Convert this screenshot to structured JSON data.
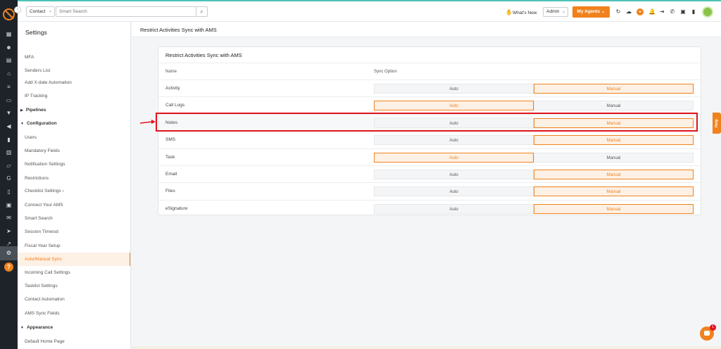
{
  "colors": {
    "accent": "#f0821e",
    "highlight": "#e0141e",
    "rail": "#1e2329"
  },
  "topbar": {
    "context_select": "Contact",
    "search_placeholder": "Smart Search",
    "whats_new": "What's New",
    "role_select": "Admin",
    "my_agents": "My Agents"
  },
  "sidebar": {
    "title": "Settings",
    "items": [
      {
        "label": "MFA",
        "type": "item"
      },
      {
        "label": "Senders List",
        "type": "item"
      },
      {
        "label": "Add X-date Automation",
        "type": "item"
      },
      {
        "label": "IP Tracking",
        "type": "item"
      },
      {
        "label": "Pipelines",
        "type": "section"
      },
      {
        "label": "Configuration",
        "type": "section"
      },
      {
        "label": "Users",
        "type": "item"
      },
      {
        "label": "Mandatory Fields",
        "type": "item"
      },
      {
        "label": "Notification Settings",
        "type": "item"
      },
      {
        "label": "Restrictions",
        "type": "item"
      },
      {
        "label": "Checklist Settings",
        "type": "item"
      },
      {
        "label": "Connect Your AMS",
        "type": "item"
      },
      {
        "label": "Smart Search",
        "type": "item"
      },
      {
        "label": "Session Timeout",
        "type": "item"
      },
      {
        "label": "Fiscal Year Setup",
        "type": "item"
      },
      {
        "label": "Auto/Manual Sync",
        "type": "item-active"
      },
      {
        "label": "Incoming Call Settings",
        "type": "item"
      },
      {
        "label": "Tasklist Settings",
        "type": "item"
      },
      {
        "label": "Contact Automation",
        "type": "item"
      },
      {
        "label": "AMS Sync Fields",
        "type": "item"
      },
      {
        "label": "Appearance",
        "type": "section"
      },
      {
        "label": "Default Home Page",
        "type": "item"
      }
    ]
  },
  "main": {
    "header_title": "Restrict Activities Sync with AMS",
    "card_title": "Restrict Activities Sync with AMS",
    "col_name": "Name",
    "col_sync": "Sync Option",
    "auto_label": "Auto",
    "manual_label": "Manual",
    "rows": [
      {
        "name": "Activity",
        "selected": "Manual"
      },
      {
        "name": "Call Logs",
        "selected": "Auto"
      },
      {
        "name": "Notes",
        "selected": "Manual"
      },
      {
        "name": "SMS",
        "selected": "Manual"
      },
      {
        "name": "Task",
        "selected": "Auto"
      },
      {
        "name": "Email",
        "selected": "Manual"
      },
      {
        "name": "Files",
        "selected": "Manual"
      },
      {
        "name": "eSignature",
        "selected": "Manual"
      }
    ]
  },
  "help_tab": "Help",
  "chat_badge": "1"
}
